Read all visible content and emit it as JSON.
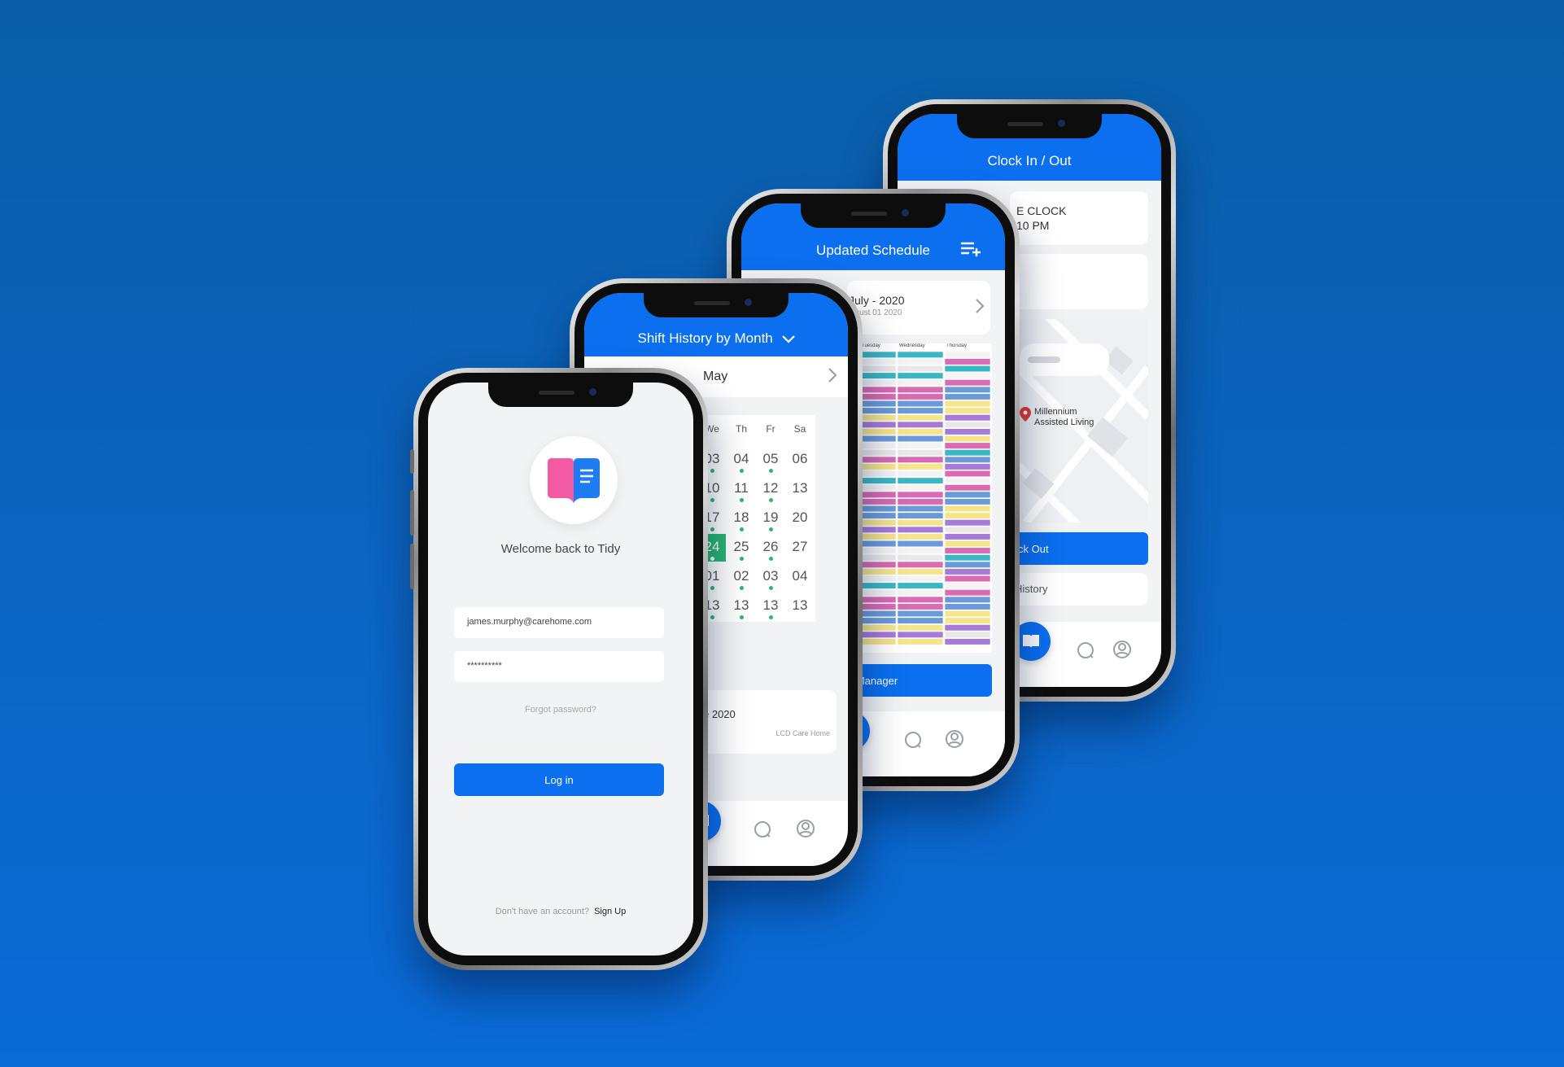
{
  "login": {
    "welcome": "Welcome back to Tidy",
    "email_value": "james.murphy@carehome.com",
    "password_value": "**********",
    "forgot": "Forgot password?",
    "login_button": "Log in",
    "no_account": "Don't have an account?",
    "signup": "Sign Up"
  },
  "history": {
    "title": "Shift History by Month",
    "month": "May",
    "weekdays": [
      "We",
      "Th",
      "Fr",
      "Sa"
    ],
    "rows": [
      [
        "03",
        "04",
        "05",
        "06"
      ],
      [
        "10",
        "11",
        "12",
        "13"
      ],
      [
        "17",
        "18",
        "19",
        "20"
      ],
      [
        "24",
        "25",
        "26",
        "27"
      ],
      [
        "01",
        "02",
        "03",
        "04"
      ],
      [
        "13",
        "13",
        "13",
        "13"
      ]
    ],
    "selected_day": "24",
    "card_date": "e 2020",
    "card_place": "LCD Care Home"
  },
  "schedule": {
    "title": "Updated Schedule",
    "period": "July - 2020",
    "period_sub": "ugust 01 2020",
    "columns": [
      "Tuesday",
      "Wednesday",
      "Thursday"
    ],
    "button": "h Manager"
  },
  "clock": {
    "title": "Clock In / Out",
    "card_title": "E CLOCK",
    "card_time": "10 PM",
    "map_place_line1": "Millennium",
    "map_place_line2": "Assisted Living",
    "clock_out_button": "ck Out",
    "history_link": "History"
  },
  "colors": {
    "primary": "#0b6ff0",
    "accent_green": "#2bb673",
    "logo_pink": "#f25aa3",
    "logo_blue": "#1e7df2"
  }
}
